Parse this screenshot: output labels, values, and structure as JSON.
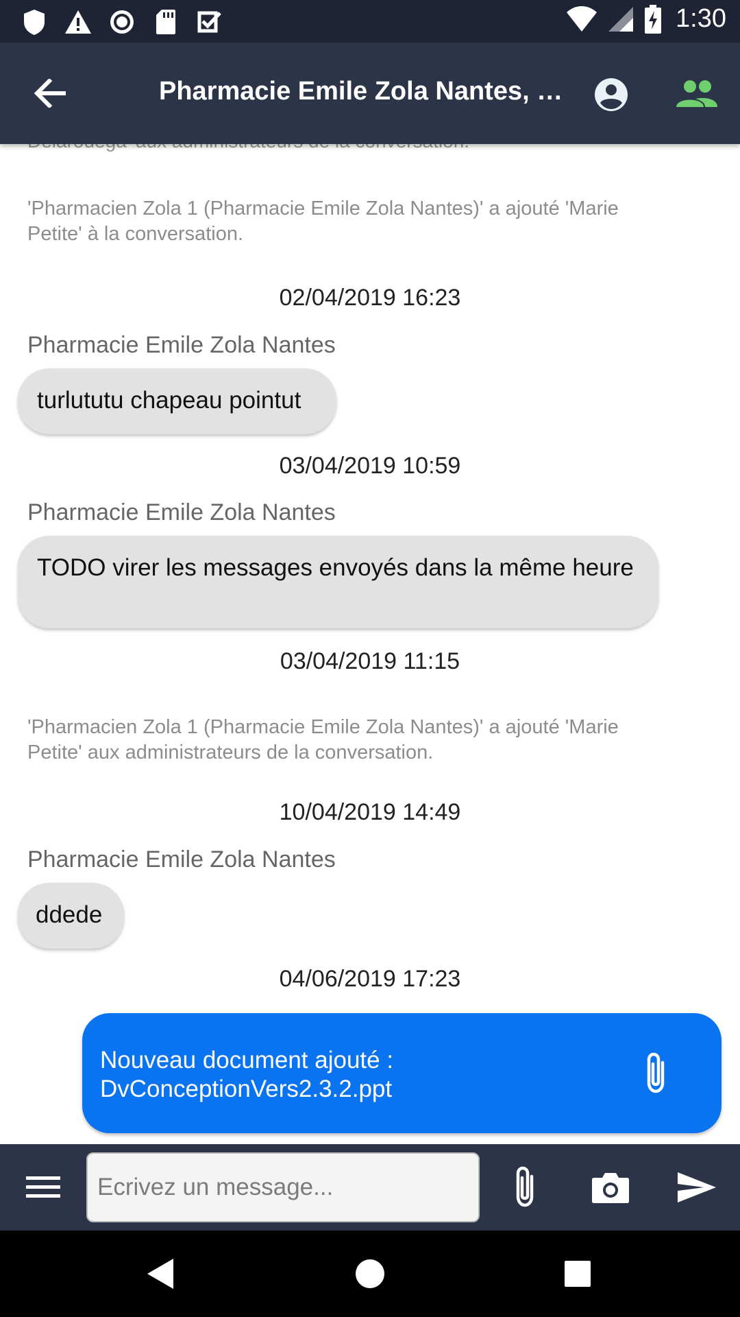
{
  "status_bar": {
    "time": "1:30",
    "left_icons": [
      "shield-icon",
      "warning-icon",
      "record-icon",
      "sd-card-icon",
      "checkbox-icon"
    ],
    "right_icons": [
      "wifi-icon",
      "signal-icon",
      "battery-charging-icon"
    ]
  },
  "header": {
    "title": "Pharmacie Emile Zola Nantes, Marie Petite",
    "icons": [
      "arrow-back-icon",
      "account-circle-icon",
      "group-icon"
    ],
    "colors": {
      "bar": "#2c3547",
      "group_icon": "#6fcf6f"
    }
  },
  "chat": {
    "cut_text": "Delarouega' aux administrateurs de la conversation.",
    "system_1": "'Pharmacien Zola 1 (Pharmacie Emile Zola Nantes)' a ajouté 'Marie Petite' à la conversation.",
    "stamp_1": "02/04/2019 16:23",
    "sender_1": "Pharmacie Emile Zola Nantes",
    "message_1": "turlututu chapeau pointut",
    "stamp_2": "03/04/2019 10:59",
    "sender_2": "Pharmacie Emile Zola Nantes",
    "message_2": "TODO virer les messages envoyés dans la même heure",
    "stamp_3": "03/04/2019 11:15",
    "system_2": "'Pharmacien Zola 1 (Pharmacie Emile Zola Nantes)' a ajouté 'Marie Petite' aux administrateurs de la conversation.",
    "stamp_4": "10/04/2019 14:49",
    "sender_3": "Pharmacie Emile Zola Nantes",
    "message_3": "ddede",
    "stamp_5": "04/06/2019 17:23",
    "outgoing": "Nouveau document ajouté : DvConceptionVers2.3.2.ppt",
    "colors": {
      "incoming_bubble": "#e2e2e2",
      "outgoing_bubble": "#0a74f0"
    }
  },
  "composer": {
    "placeholder": "Ecrivez un message...",
    "value": "",
    "icons": [
      "menu-icon",
      "attach-icon",
      "camera-icon",
      "send-icon"
    ]
  },
  "nav": {
    "icons": [
      "back-triangle-icon",
      "home-circle-icon",
      "recents-square-icon"
    ]
  }
}
